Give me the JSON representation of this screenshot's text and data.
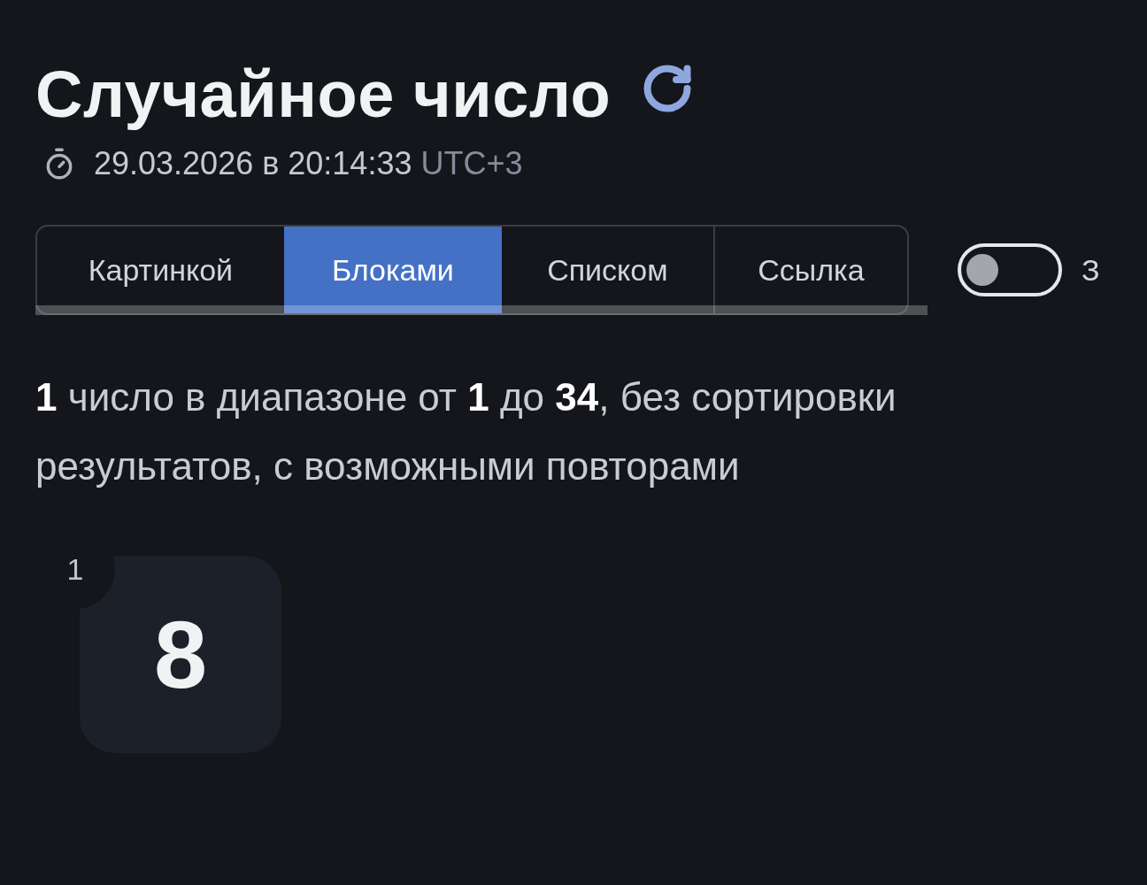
{
  "header": {
    "title": "Случайное число",
    "timestamp": "29.03.2026 в 20:14:33",
    "timezone": "UTC+3"
  },
  "tabs": [
    {
      "label": "Картинкой",
      "selected": false
    },
    {
      "label": "Блоками",
      "selected": true
    },
    {
      "label": "Списком",
      "selected": false
    },
    {
      "label": "Ссылка",
      "selected": false
    }
  ],
  "toggle": {
    "on": false,
    "label": "З"
  },
  "description": "**1** число в диапазоне от **1** до **34**, без сортировки результатов, с возможными повторами",
  "results": [
    {
      "index": "1",
      "value": "8"
    }
  ]
}
